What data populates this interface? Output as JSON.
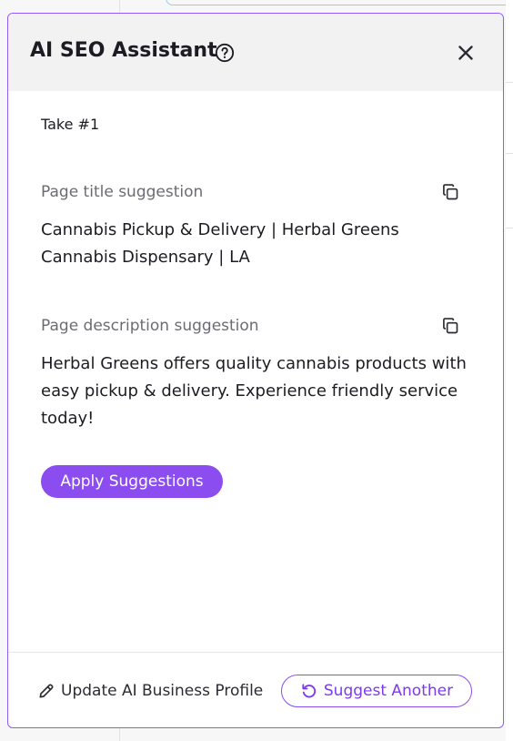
{
  "panel": {
    "title": "AI SEO Assistant",
    "take_label": "Take #1",
    "title_section": {
      "label": "Page title suggestion",
      "text": "Cannabis Pickup & Delivery | Herbal Greens Cannabis Dispensary | LA"
    },
    "description_section": {
      "label": "Page description suggestion",
      "text": "Herbal Greens offers quality cannabis products with easy pickup & delivery. Experience friendly service today!"
    },
    "apply_button": "Apply Suggestions",
    "footer": {
      "update_link": "Update AI Business Profile",
      "suggest_button": "Suggest Another"
    }
  },
  "icons": {
    "help": "help-circle-icon",
    "close": "close-icon",
    "copy": "copy-icon",
    "edit": "pencil-icon",
    "refresh": "refresh-icon"
  },
  "colors": {
    "accent": "#8b4cf0",
    "panel_border": "#8b5cf6",
    "header_bg": "#f2f2f3",
    "text_primary": "#1c1c22",
    "text_secondary": "#6b6b73"
  }
}
